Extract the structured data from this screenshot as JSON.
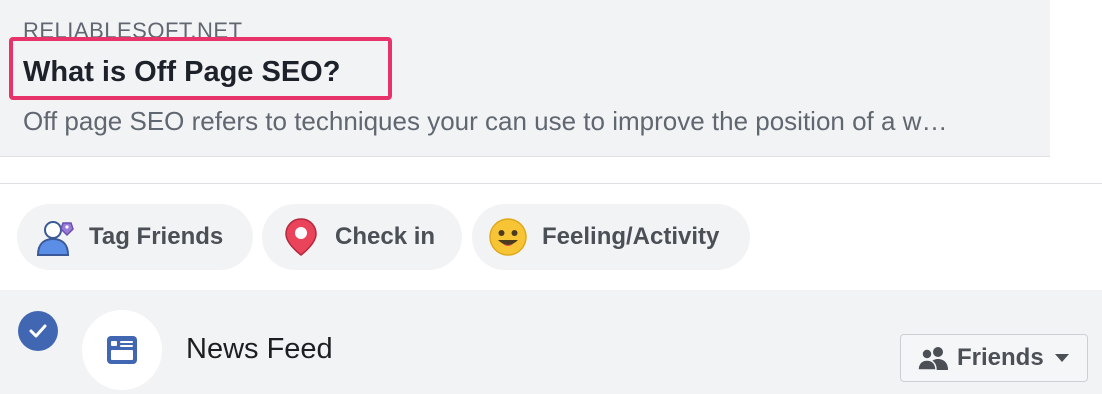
{
  "preview": {
    "domain": "RELIABLESOFT.NET",
    "title": "What is Off Page SEO?",
    "description": "Off page SEO refers to techniques your can use to improve the position of a w…"
  },
  "actions": {
    "tag_friends": "Tag Friends",
    "check_in": "Check in",
    "feeling": "Feeling/Activity"
  },
  "audience": {
    "news_feed_label": "News Feed",
    "privacy_label": "Friends",
    "news_feed_selected": true
  },
  "icons": {
    "tag": "tag-friends-icon",
    "checkin": "location-pin-icon",
    "feeling": "smiley-face-icon",
    "check": "checkmark-icon",
    "newsfeed": "news-feed-icon",
    "people": "people-icon",
    "caret": "caret-down-icon"
  },
  "colors": {
    "highlight": "#e8336a",
    "fb_blue": "#4267b2",
    "pin_red": "#e9445a",
    "smiley_yellow": "#f7c435"
  }
}
